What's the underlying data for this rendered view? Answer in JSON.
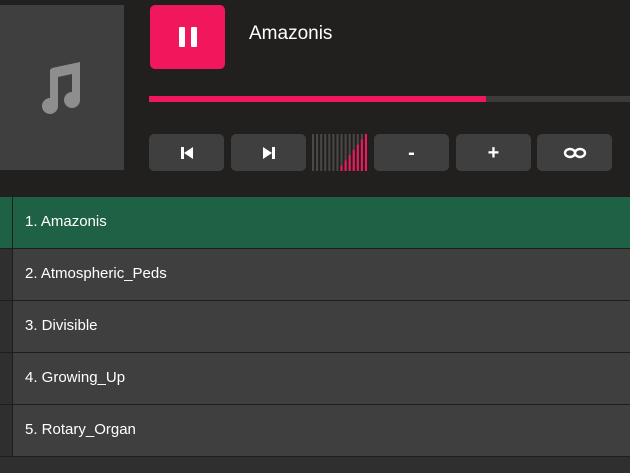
{
  "now_playing": {
    "title": "Amazonis",
    "progress_fraction": 0.7
  },
  "controls": {
    "play_pause_icon": "pause-icon",
    "prev_icon": "skip-previous-icon",
    "next_icon": "skip-next-icon",
    "volume_down_label": "-",
    "volume_up_label": "+",
    "loop_icon": "loop-icon",
    "volume_level_fraction": 0.5
  },
  "colors": {
    "accent": "#f1175d",
    "active_row": "#1f6145",
    "panel": "#221f1f",
    "button": "#3f3f3f"
  },
  "playlist": {
    "items": [
      {
        "label": "1. Amazonis",
        "active": true
      },
      {
        "label": "2. Atmospheric_Peds",
        "active": false
      },
      {
        "label": "3. Divisible",
        "active": false
      },
      {
        "label": "4. Growing_Up",
        "active": false
      },
      {
        "label": "5. Rotary_Organ",
        "active": false
      }
    ]
  }
}
